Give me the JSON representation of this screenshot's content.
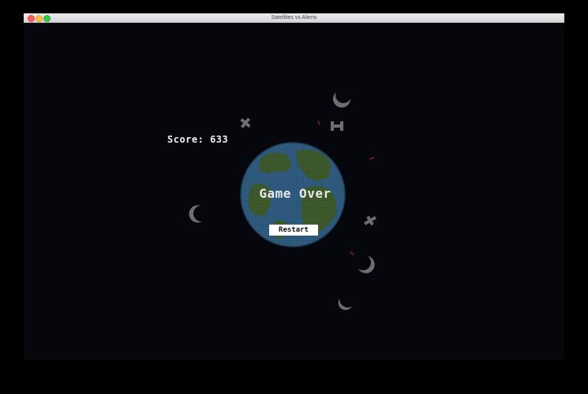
{
  "window": {
    "title": "Satellites vs Aliens"
  },
  "hud": {
    "score_label": "Score: 633"
  },
  "overlay": {
    "game_over": "Game Over",
    "restart_label": "Restart"
  },
  "colors": {
    "space_background": "#05070c",
    "ocean": "#2f5b7e",
    "land": "#3d5a2c",
    "sprite_grey": "#6e6e6e",
    "laser_red": "#8c1a1a"
  },
  "icons": {
    "planet": "earth-icon",
    "alien": "crescent-alien-icon",
    "satellite": "satellite-icon"
  }
}
